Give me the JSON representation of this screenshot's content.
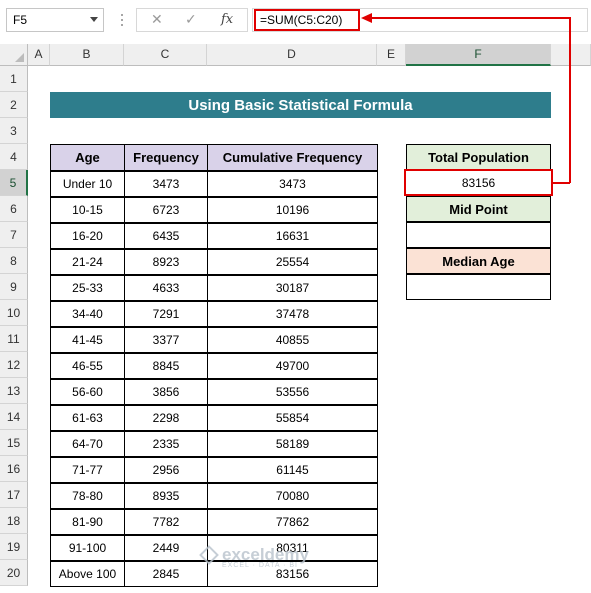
{
  "namebox": {
    "value": "F5"
  },
  "formula_bar": {
    "cancel": "✕",
    "enter": "✓",
    "fx": "fx",
    "formula": "=SUM(C5:C20)"
  },
  "columns": [
    "A",
    "B",
    "C",
    "D",
    "E",
    "F"
  ],
  "rows": [
    "1",
    "2",
    "3",
    "4",
    "5",
    "6",
    "7",
    "8",
    "9",
    "10",
    "11",
    "12",
    "13",
    "14",
    "15",
    "16",
    "17",
    "18",
    "19",
    "20"
  ],
  "title": "Using Basic Statistical Formula",
  "table": {
    "headers": [
      "Age",
      "Frequency",
      "Cumulative Frequency"
    ],
    "rows": [
      [
        "Under 10",
        "3473",
        "3473"
      ],
      [
        "10-15",
        "6723",
        "10196"
      ],
      [
        "16-20",
        "6435",
        "16631"
      ],
      [
        "21-24",
        "8923",
        "25554"
      ],
      [
        "25-33",
        "4633",
        "30187"
      ],
      [
        "34-40",
        "7291",
        "37478"
      ],
      [
        "41-45",
        "3377",
        "40855"
      ],
      [
        "46-55",
        "8845",
        "49700"
      ],
      [
        "56-60",
        "3856",
        "53556"
      ],
      [
        "61-63",
        "2298",
        "55854"
      ],
      [
        "64-70",
        "2335",
        "58189"
      ],
      [
        "71-77",
        "2956",
        "61145"
      ],
      [
        "78-80",
        "8935",
        "70080"
      ],
      [
        "81-90",
        "7782",
        "77862"
      ],
      [
        "91-100",
        "2449",
        "80311"
      ],
      [
        "Above 100",
        "2845",
        "83156"
      ]
    ]
  },
  "side": {
    "total_population_label": "Total Population",
    "total_population_value": "83156",
    "mid_point_label": "Mid Point",
    "mid_point_value": "",
    "median_age_label": "Median Age",
    "median_age_value": ""
  },
  "watermark": {
    "name": "exceldemy",
    "tagline": "EXCEL · DATA · BI"
  },
  "colors": {
    "banner": "#2e7d8c",
    "header": "#d9d2e9",
    "green": "#e2efda",
    "peach": "#fbe2d5",
    "highlight": "#e00000"
  }
}
